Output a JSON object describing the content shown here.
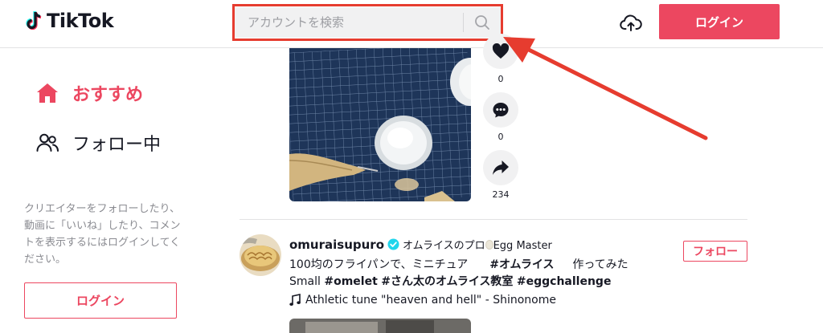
{
  "app": {
    "name": "TikTok"
  },
  "header": {
    "search": {
      "placeholder": "アカウントを検索",
      "value": ""
    },
    "login_label": "ログイン"
  },
  "sidebar": {
    "items": [
      {
        "label": "おすすめ",
        "icon": "home-icon",
        "active": true
      },
      {
        "label": "フォロー中",
        "icon": "users-icon",
        "active": false
      }
    ],
    "login_prompt": "クリエイターをフォローしたり、動画に「いいね」したり、コメントを表示するにはログインしてください。",
    "login_label": "ログイン"
  },
  "feed": {
    "actions": [
      {
        "icon": "heart-icon",
        "count": "0"
      },
      {
        "icon": "comment-icon",
        "count": "0"
      },
      {
        "icon": "share-icon",
        "count": "234"
      }
    ],
    "post": {
      "username": "omuraisupuro",
      "verified": true,
      "nickname": "オムライスのプロ",
      "nickname_suffix": "Egg Master",
      "caption_text_1": "100均のフライパンで、ミニチュア",
      "caption_tag_1": "#オムライス",
      "caption_text_2": "作ってみた",
      "caption_text_3": "Small",
      "caption_tags_2": [
        "#omelet",
        "#さん太のオムライス教室",
        "#eggchallenge"
      ],
      "music": "Athletic tune \"heaven and hell\" - Shinonome",
      "follow_label": "フォロー"
    }
  },
  "colors": {
    "brand": "#ec4760",
    "annotation": "#e63c2f"
  }
}
